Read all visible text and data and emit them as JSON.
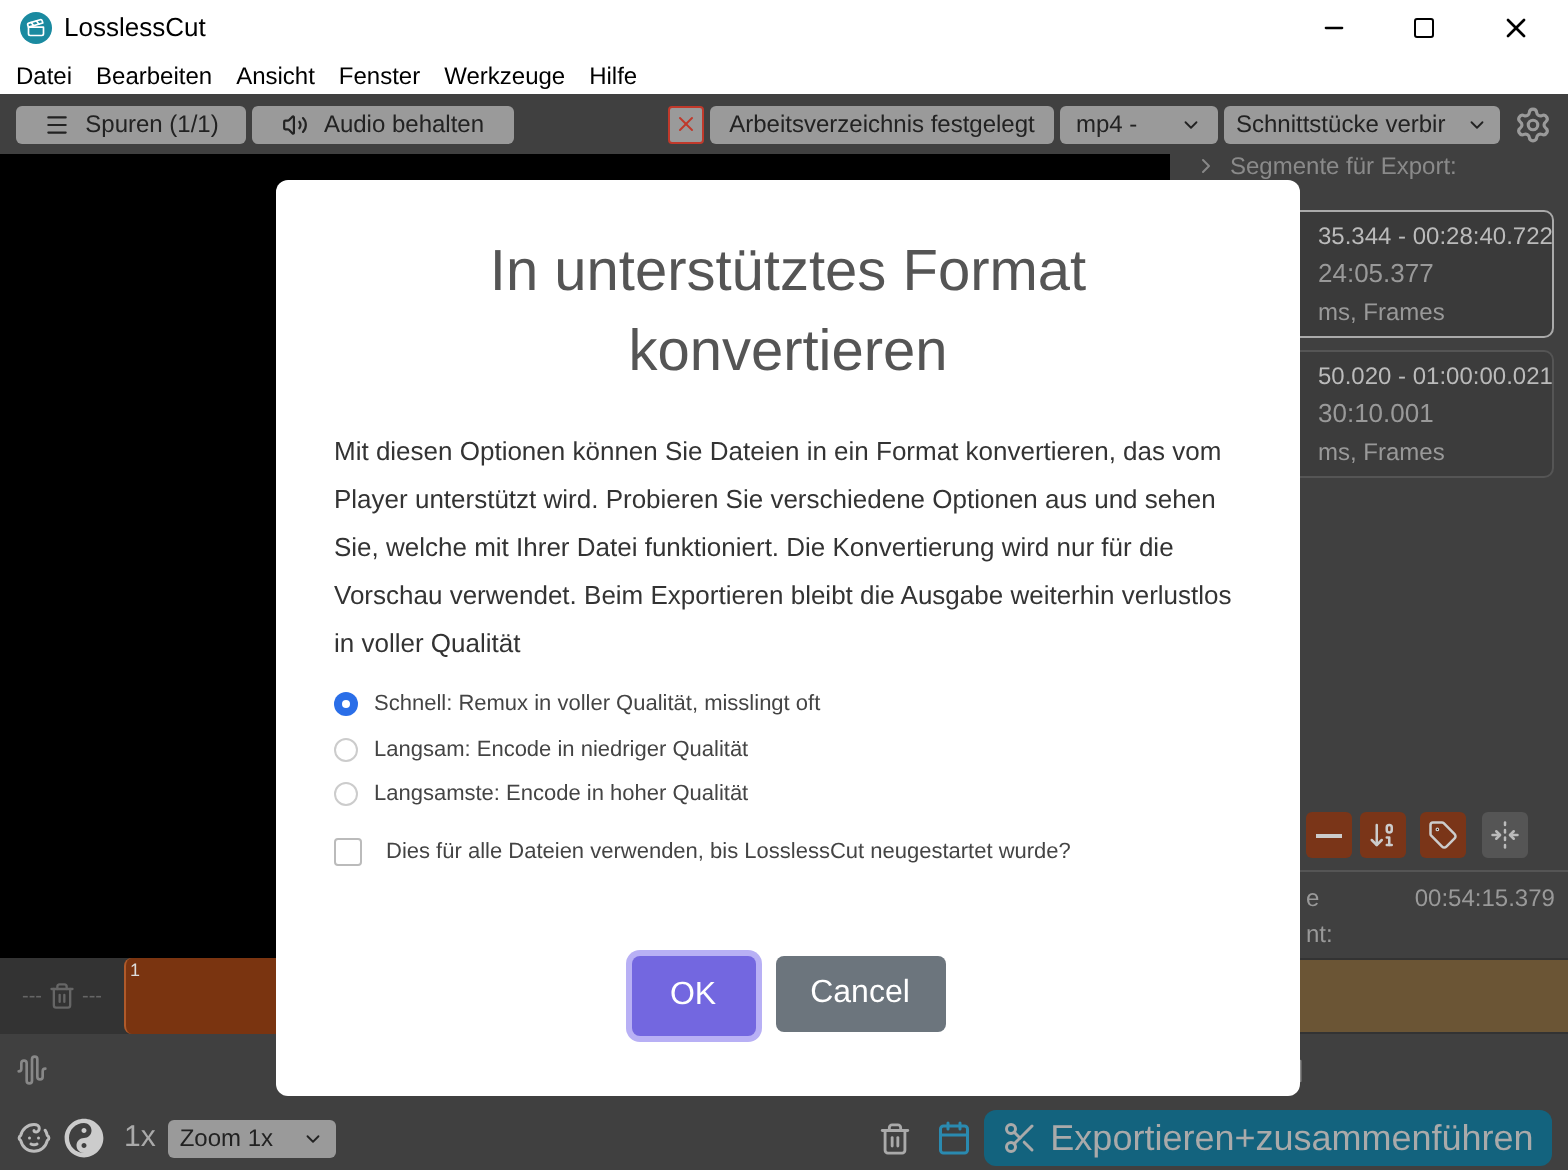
{
  "window": {
    "title": "LosslessCut"
  },
  "menu": [
    "Datei",
    "Bearbeiten",
    "Ansicht",
    "Fenster",
    "Werkzeuge",
    "Hilfe"
  ],
  "toolbar": {
    "tracks": "Spuren (1/1)",
    "audio": "Audio behalten",
    "workdir": "Arbeitsverzeichnis festgelegt",
    "format": "mp4 -",
    "mode": "Schnittstücke verbir"
  },
  "side_panel": {
    "heading": "Segmente für Export:",
    "segments": [
      {
        "range": "35.344 - 00:28:40.722",
        "duration": "24:05.377",
        "units": "ms, Frames",
        "selected": true
      },
      {
        "range": "50.020 - 01:00:00.021",
        "duration": "30:10.001",
        "units": "ms, Frames",
        "selected": false
      }
    ],
    "label_1": "e",
    "label_2": "nt:",
    "total": "00:54:15.379"
  },
  "timeline": {
    "segment_number": "1",
    "dash_left": "---",
    "dash_right": "---"
  },
  "bottom_bar": {
    "speed": "1x",
    "zoom": "Zoom 1x",
    "export": "Exportieren+zusammenführen"
  },
  "dialog": {
    "title": "In unterstütztes Format konvertieren",
    "text": "Mit diesen Optionen können Sie Dateien in ein Format konvertieren, das vom Player unterstützt wird. Probieren Sie verschiedene Optionen aus und sehen Sie, welche mit Ihrer Datei funktioniert. Die Konvertierung wird nur für die Vorschau verwendet. Beim Exportieren bleibt die Ausgabe weiterhin verlustlos in voller Qualität",
    "options": [
      {
        "label": "Schnell: Remux in voller Qualität, misslingt oft",
        "selected": true
      },
      {
        "label": "Langsam: Encode in niedriger Qualität",
        "selected": false
      },
      {
        "label": "Langsamste: Encode in hoher Qualität",
        "selected": false
      }
    ],
    "remember": {
      "label": "Dies für alle Dateien verwenden, bis LosslessCut neugestartet wurde?",
      "checked": false
    },
    "buttons": [
      "OK",
      "Cancel"
    ]
  }
}
